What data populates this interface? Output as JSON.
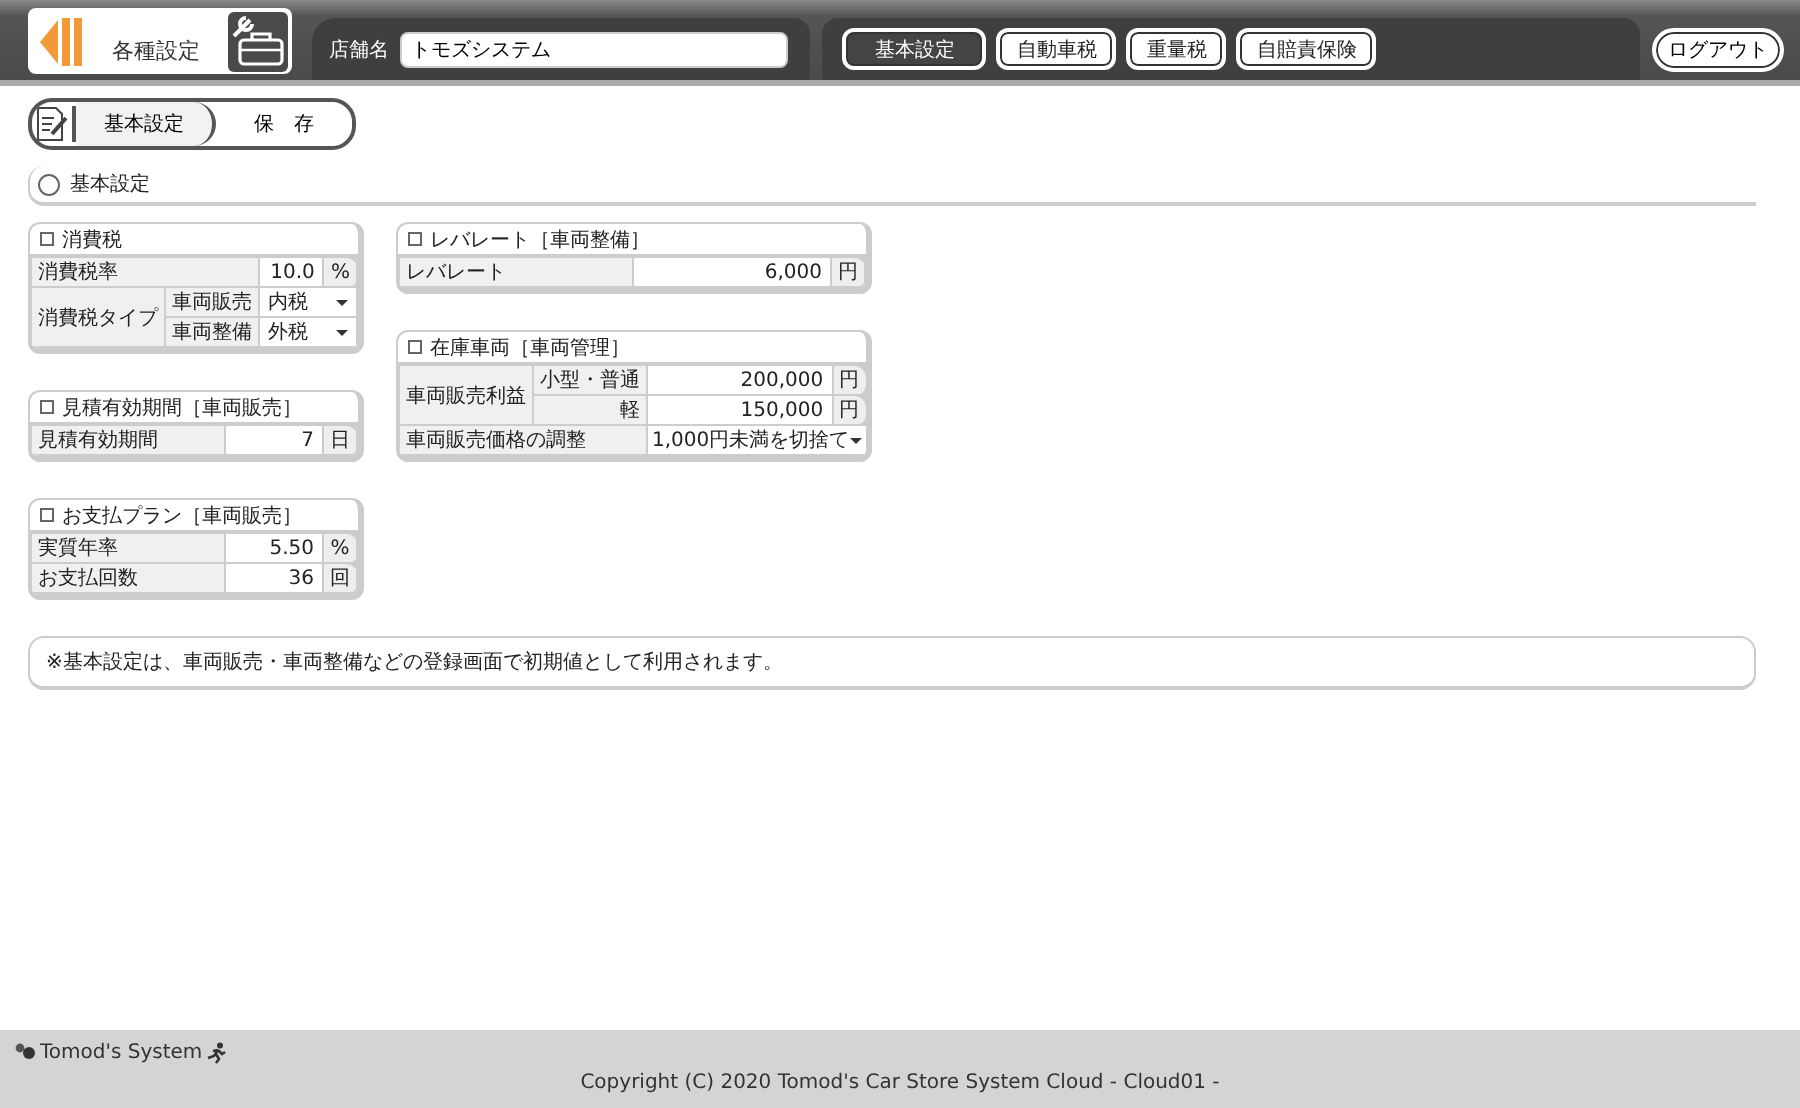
{
  "header": {
    "title": "各種設定",
    "store_label": "店舗名",
    "store_value": "トモズシステム",
    "nav": [
      {
        "label": "基本設定",
        "selected": true
      },
      {
        "label": "自動車税",
        "selected": false
      },
      {
        "label": "重量税",
        "selected": false
      },
      {
        "label": "自賠責保険",
        "selected": false
      }
    ],
    "logout": "ログアウト"
  },
  "toolbar": [
    {
      "label": "基本設定",
      "selected": true
    },
    {
      "label": "保　存",
      "selected": false
    }
  ],
  "section_title": "基本設定",
  "columns": [
    [
      {
        "title": "消費税",
        "rows": [
          {
            "kind": "input",
            "label": "消費税率",
            "value": "10.0",
            "unit": "%"
          },
          {
            "kind": "group",
            "label": "消費税タイプ",
            "items": [
              {
                "kind": "select",
                "sublabel": "車両販売",
                "value": "内税"
              },
              {
                "kind": "select",
                "sublabel": "車両整備",
                "value": "外税"
              }
            ]
          }
        ]
      },
      {
        "title": "見積有効期間［車両販売］",
        "rows": [
          {
            "kind": "input",
            "label": "見積有効期間",
            "value": "7",
            "unit": "日"
          }
        ]
      },
      {
        "title": "お支払プラン［車両販売］",
        "rows": [
          {
            "kind": "input",
            "label": "実質年率",
            "value": "5.50",
            "unit": "%"
          },
          {
            "kind": "input",
            "label": "お支払回数",
            "value": "36",
            "unit": "回"
          }
        ]
      }
    ],
    [
      {
        "title": "レバレート［車両整備］",
        "rows": [
          {
            "kind": "input",
            "label": "レバレート",
            "value": "6,000",
            "unit": "円"
          }
        ]
      },
      {
        "title": "在庫車両［車両管理］",
        "rows": [
          {
            "kind": "group",
            "label": "車両販売利益",
            "items": [
              {
                "kind": "input",
                "sublabel": "小型・普通",
                "value": "200,000",
                "unit": "円"
              },
              {
                "kind": "input",
                "sublabel": "軽",
                "value": "150,000",
                "unit": "円"
              }
            ]
          },
          {
            "kind": "select",
            "label": "車両販売価格の調整",
            "value": "1,000円未満を切捨て"
          }
        ]
      }
    ]
  ],
  "note": "※基本設定は、車両販売・車両整備などの登録画面で初期値として利用されます。",
  "footer": {
    "brand": "Tomod's System",
    "copyright": "Copyright (C) 2020 Tomod's Car Store System Cloud - Cloud01 -"
  }
}
